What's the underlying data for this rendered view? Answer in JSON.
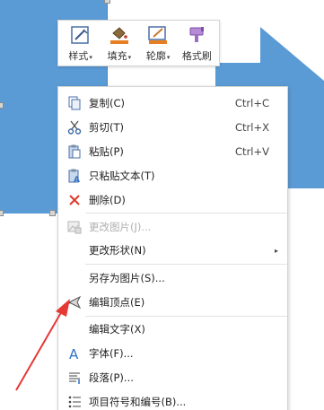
{
  "mini_toolbar": {
    "items": [
      {
        "label": "样式",
        "icon": "style-brush-icon",
        "has_dropdown": true
      },
      {
        "label": "填充",
        "icon": "fill-bucket-icon",
        "has_dropdown": true
      },
      {
        "label": "轮廓",
        "icon": "outline-pen-icon",
        "has_dropdown": true
      },
      {
        "label": "格式刷",
        "icon": "format-painter-icon",
        "has_dropdown": false
      }
    ],
    "dropdown_glyph": "▾"
  },
  "context_menu": {
    "items": [
      {
        "label": "复制(C)",
        "shortcut": "Ctrl+C",
        "icon": "copy-icon",
        "disabled": false
      },
      {
        "label": "剪切(T)",
        "shortcut": "Ctrl+X",
        "icon": "scissors-icon",
        "disabled": false
      },
      {
        "label": "粘贴(P)",
        "shortcut": "Ctrl+V",
        "icon": "paste-icon",
        "disabled": false
      },
      {
        "label": "只粘贴文本(T)",
        "shortcut": "",
        "icon": "paste-text-icon",
        "disabled": false
      },
      {
        "label": "删除(D)",
        "shortcut": "",
        "icon": "delete-x-icon",
        "disabled": false
      },
      {
        "label": "更改图片(J)...",
        "shortcut": "",
        "icon": "change-picture-icon",
        "disabled": true
      },
      {
        "label": "更改形状(N)",
        "shortcut": "",
        "icon": "",
        "disabled": false,
        "submenu": true
      },
      {
        "label": "另存为图片(S)...",
        "shortcut": "",
        "icon": "",
        "disabled": false
      },
      {
        "label": "编辑顶点(E)",
        "shortcut": "",
        "icon": "edit-points-icon",
        "disabled": false
      },
      {
        "label": "编辑文字(X)",
        "shortcut": "",
        "icon": "",
        "disabled": false
      },
      {
        "label": "字体(F)...",
        "shortcut": "",
        "icon": "font-icon",
        "disabled": false
      },
      {
        "label": "段落(P)...",
        "shortcut": "",
        "icon": "paragraph-icon",
        "disabled": false
      },
      {
        "label": "项目符号和编号(B)...",
        "shortcut": "",
        "icon": "bullets-icon",
        "disabled": false
      }
    ],
    "submenu_glyph": "▸"
  },
  "colors": {
    "shape_fill": "#5b9bd5",
    "annotation_arrow": "#e53935",
    "delete_icon": "#e0392b",
    "font_icon": "#2f6fc8"
  }
}
